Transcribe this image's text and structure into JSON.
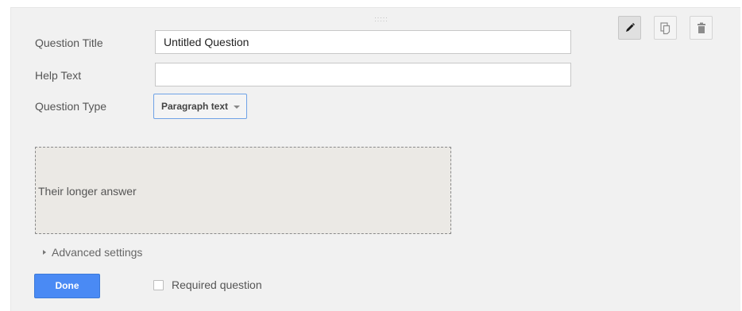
{
  "form": {
    "question_title": {
      "label": "Question Title",
      "value": "Untitled Question"
    },
    "help_text": {
      "label": "Help Text",
      "value": ""
    },
    "question_type": {
      "label": "Question Type",
      "selected": "Paragraph text"
    },
    "preview": {
      "placeholder": "Their longer answer"
    },
    "advanced_settings_label": "Advanced settings",
    "done_label": "Done",
    "required": {
      "label": "Required question",
      "checked": false
    }
  },
  "toolbar": {
    "icons": [
      "pencil-icon",
      "duplicate-icon",
      "trash-icon"
    ],
    "active": "pencil-icon"
  },
  "colors": {
    "accent": "#4a8af4",
    "card_bg": "#f1f1f1",
    "preview_bg": "#ebe9e5"
  }
}
